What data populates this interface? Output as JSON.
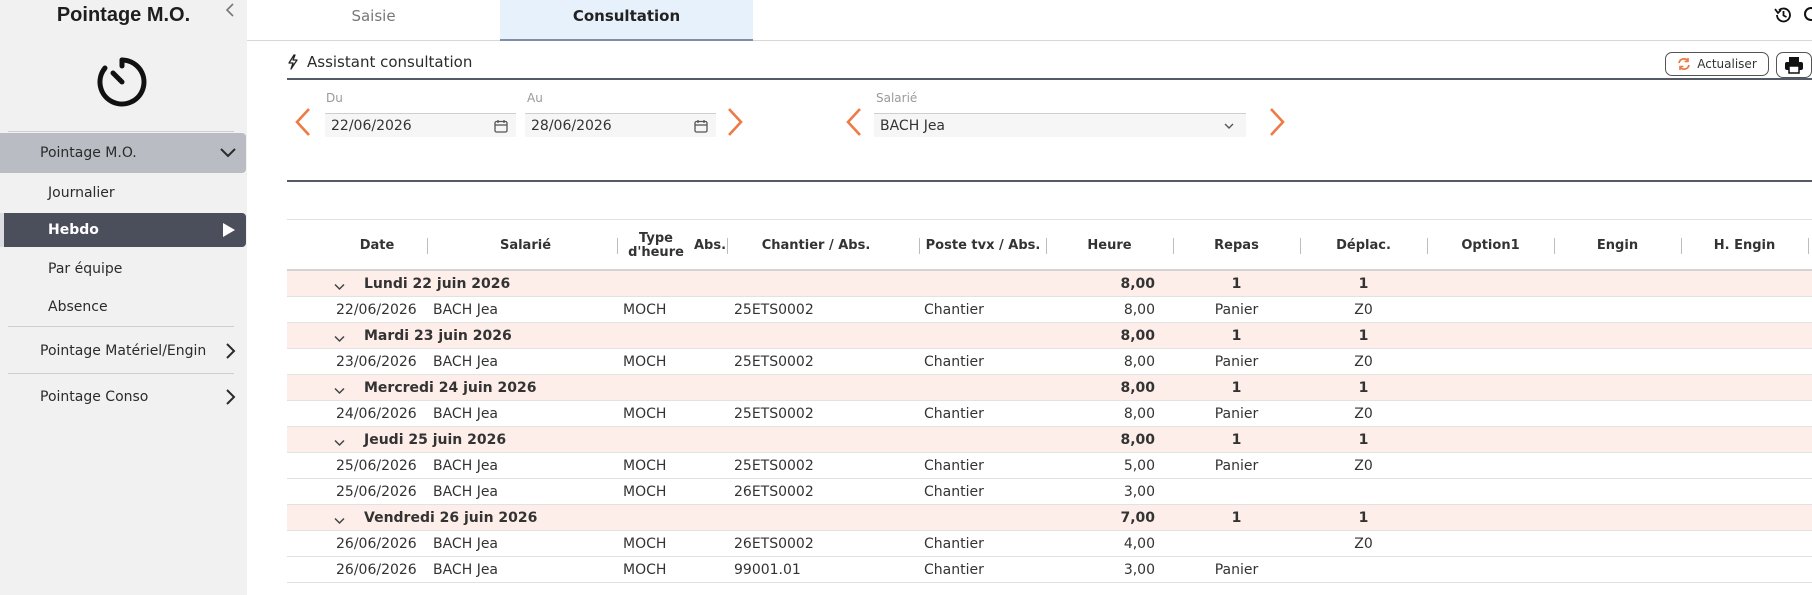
{
  "sidebar": {
    "title": "Pointage M.O.",
    "collapse_icon": "chevron-left-icon",
    "nav": {
      "group1": "Pointage M.O.",
      "sub1": "Journalier",
      "sub2": "Hebdo",
      "sub3": "Par équipe",
      "sub4": "Absence",
      "group2": "Pointage Matériel/Engin",
      "group3": "Pointage Conso"
    }
  },
  "tabs": {
    "saisie": "Saisie",
    "consultation": "Consultation"
  },
  "assistant": {
    "title": "Assistant consultation",
    "refresh_label": "Actualiser",
    "du_label": "Du",
    "du_value": "22/06/2026",
    "au_label": "Au",
    "au_value": "28/06/2026",
    "salarie_label": "Salarié",
    "salarie_value": "BACH Jea"
  },
  "table": {
    "headers": {
      "date": "Date",
      "salarie": "Salarié",
      "type_heure_1": "Type",
      "type_heure_2": "d'heure",
      "abs": "Abs.",
      "chantier": "Chantier / Abs.",
      "poste": "Poste tvx / Abs.",
      "heure": "Heure",
      "repas": "Repas",
      "deplac": "Déplac.",
      "option1": "Option1",
      "engin": "Engin",
      "h_engin": "H. Engin"
    },
    "rows": [
      {
        "group": true,
        "label": "Lundi 22 juin 2026",
        "heure": "8,00",
        "repas": "1",
        "deplac": "1"
      },
      {
        "date": "22/06/2026",
        "salarie": "BACH Jea",
        "type": "MOCH",
        "chantier": "25ETS0002",
        "poste": "Chantier",
        "heure": "8,00",
        "repas": "Panier",
        "deplac": "Z0"
      },
      {
        "group": true,
        "label": "Mardi 23 juin 2026",
        "heure": "8,00",
        "repas": "1",
        "deplac": "1"
      },
      {
        "date": "23/06/2026",
        "salarie": "BACH Jea",
        "type": "MOCH",
        "chantier": "25ETS0002",
        "poste": "Chantier",
        "heure": "8,00",
        "repas": "Panier",
        "deplac": "Z0"
      },
      {
        "group": true,
        "label": "Mercredi 24 juin 2026",
        "heure": "8,00",
        "repas": "1",
        "deplac": "1"
      },
      {
        "date": "24/06/2026",
        "salarie": "BACH Jea",
        "type": "MOCH",
        "chantier": "25ETS0002",
        "poste": "Chantier",
        "heure": "8,00",
        "repas": "Panier",
        "deplac": "Z0"
      },
      {
        "group": true,
        "label": "Jeudi 25 juin 2026",
        "heure": "8,00",
        "repas": "1",
        "deplac": "1"
      },
      {
        "date": "25/06/2026",
        "salarie": "BACH Jea",
        "type": "MOCH",
        "chantier": "25ETS0002",
        "poste": "Chantier",
        "heure": "5,00",
        "repas": "Panier",
        "deplac": "Z0"
      },
      {
        "date": "25/06/2026",
        "salarie": "BACH Jea",
        "type": "MOCH",
        "chantier": "26ETS0002",
        "poste": "Chantier",
        "heure": "3,00",
        "repas": "",
        "deplac": ""
      },
      {
        "group": true,
        "label": "Vendredi 26 juin 2026",
        "heure": "7,00",
        "repas": "1",
        "deplac": "1"
      },
      {
        "date": "26/06/2026",
        "salarie": "BACH Jea",
        "type": "MOCH",
        "chantier": "26ETS0002",
        "poste": "Chantier",
        "heure": "4,00",
        "repas": "",
        "deplac": "Z0"
      },
      {
        "date": "26/06/2026",
        "salarie": "BACH Jea",
        "type": "MOCH",
        "chantier": "99001.01",
        "poste": "Chantier",
        "heure": "3,00",
        "repas": "Panier",
        "deplac": ""
      }
    ]
  },
  "colors": {
    "accent_orange": "#ee7a45",
    "active_nav": "#4b4f5c",
    "group_row": "#fdeeea",
    "tab_active": "#e7f1fb"
  }
}
